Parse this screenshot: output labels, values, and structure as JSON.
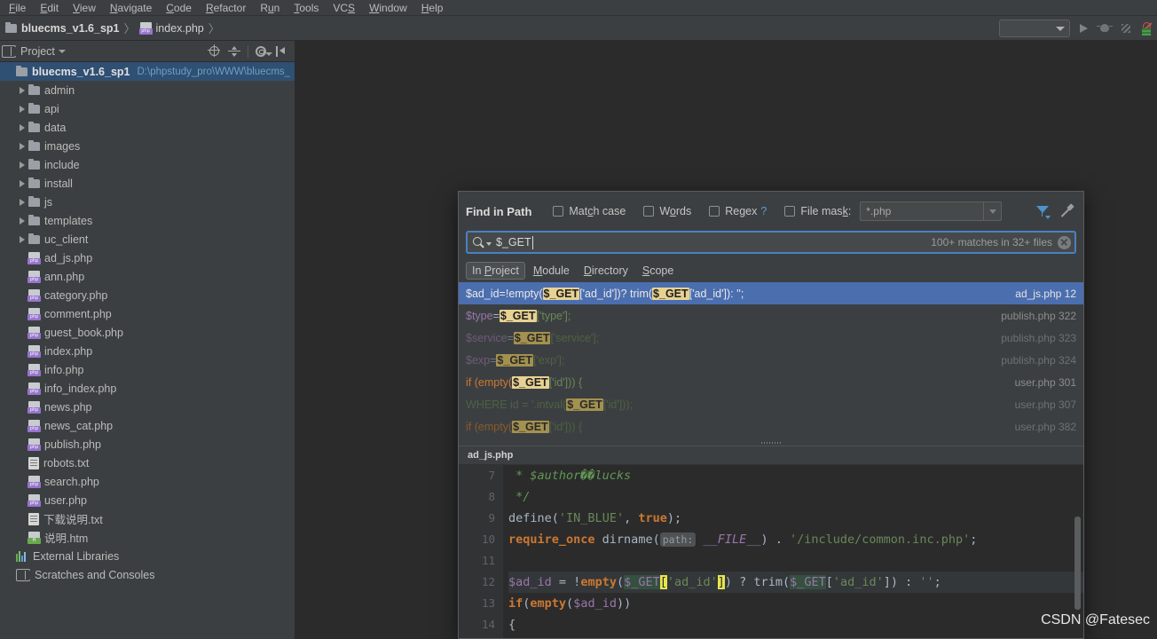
{
  "menubar": {
    "items": [
      {
        "label": "File",
        "mnemonic": "F"
      },
      {
        "label": "Edit",
        "mnemonic": "E"
      },
      {
        "label": "View",
        "mnemonic": "V"
      },
      {
        "label": "Navigate",
        "mnemonic": "N"
      },
      {
        "label": "Code",
        "mnemonic": "C"
      },
      {
        "label": "Refactor",
        "mnemonic": "R"
      },
      {
        "label": "Run",
        "mnemonic": "u"
      },
      {
        "label": "Tools",
        "mnemonic": "T"
      },
      {
        "label": "VCS",
        "mnemonic": "S"
      },
      {
        "label": "Window",
        "mnemonic": "W"
      },
      {
        "label": "Help",
        "mnemonic": "H"
      }
    ]
  },
  "breadcrumb": {
    "project": "bluecms_v1.6_sp1",
    "file": "index.php",
    "separator": "〉"
  },
  "toolbar": {
    "run_config_placeholder": "",
    "icons": [
      "run-icon",
      "debug-icon",
      "coverage-icon",
      "stop-icon"
    ]
  },
  "sidebar": {
    "title": "Project",
    "tools": [
      "locate-icon",
      "collapse-all-icon",
      "settings-gear-icon",
      "hide-panel-icon"
    ],
    "root": {
      "label": "bluecms_v1.6_sp1",
      "path": "D:\\phpstudy_pro\\WWW\\bluecms_",
      "selected": true
    },
    "folders": [
      {
        "label": "admin"
      },
      {
        "label": "api"
      },
      {
        "label": "data"
      },
      {
        "label": "images"
      },
      {
        "label": "include"
      },
      {
        "label": "install"
      },
      {
        "label": "js"
      },
      {
        "label": "templates"
      },
      {
        "label": "uc_client"
      }
    ],
    "files": [
      {
        "label": "ad_js.php",
        "type": "php"
      },
      {
        "label": "ann.php",
        "type": "php"
      },
      {
        "label": "category.php",
        "type": "php"
      },
      {
        "label": "comment.php",
        "type": "php"
      },
      {
        "label": "guest_book.php",
        "type": "php"
      },
      {
        "label": "index.php",
        "type": "php"
      },
      {
        "label": "info.php",
        "type": "php"
      },
      {
        "label": "info_index.php",
        "type": "php"
      },
      {
        "label": "news.php",
        "type": "php"
      },
      {
        "label": "news_cat.php",
        "type": "php"
      },
      {
        "label": "publish.php",
        "type": "php"
      },
      {
        "label": "robots.txt",
        "type": "txt"
      },
      {
        "label": "search.php",
        "type": "php"
      },
      {
        "label": "user.php",
        "type": "php"
      },
      {
        "label": "下载说明.txt",
        "type": "txt"
      },
      {
        "label": "说明.htm",
        "type": "htm"
      }
    ],
    "external_libraries": "External Libraries",
    "scratches": "Scratches and Consoles"
  },
  "find_dialog": {
    "title": "Find in Path",
    "options": [
      {
        "label": "Match case",
        "mnemonic": "c",
        "checked": false
      },
      {
        "label": "Words",
        "mnemonic": "o",
        "checked": false
      },
      {
        "label": "Regex",
        "mnemonic": "g",
        "checked": false,
        "help": "?"
      },
      {
        "label": "File mask:",
        "mnemonic": "k",
        "checked": false
      }
    ],
    "file_mask_value": "*.php",
    "search_value": "$_GET",
    "match_count": "100+ matches in 32+ files",
    "header_icons": [
      "filter-icon",
      "pin-icon"
    ],
    "scope_tabs": [
      {
        "label": "In Project",
        "mnemonic": "P",
        "active": true
      },
      {
        "label": "Module",
        "mnemonic": "M",
        "active": false
      },
      {
        "label": "Directory",
        "mnemonic": "D",
        "active": false
      },
      {
        "label": "Scope",
        "mnemonic": "S",
        "active": false
      }
    ],
    "results": [
      {
        "file": "ad_js.php",
        "line": "12",
        "selected": true,
        "dim": false,
        "parts": [
          {
            "t": "$ad_id",
            "c": "var"
          },
          {
            "t": " = ",
            "c": "plain"
          },
          {
            "t": "!empty(",
            "c": "kw"
          },
          {
            "t": "$_GET",
            "c": "hl"
          },
          {
            "t": "['ad_id'])",
            "c": "str"
          },
          {
            "t": " ? trim(",
            "c": "plain"
          },
          {
            "t": "$_GET",
            "c": "hl"
          },
          {
            "t": "['ad_id'])",
            "c": "str"
          },
          {
            "t": " : '';",
            "c": "plain"
          }
        ]
      },
      {
        "file": "publish.php",
        "line": "322",
        "selected": false,
        "dim": false,
        "parts": [
          {
            "t": "$type",
            "c": "var"
          },
          {
            "t": " = ",
            "c": "plain"
          },
          {
            "t": "$_GET",
            "c": "hl"
          },
          {
            "t": "['type'];",
            "c": "str"
          }
        ]
      },
      {
        "file": "publish.php",
        "line": "323",
        "selected": false,
        "dim": true,
        "parts": [
          {
            "t": "$service",
            "c": "var"
          },
          {
            "t": " = ",
            "c": "plain"
          },
          {
            "t": "$_GET",
            "c": "hl"
          },
          {
            "t": "['service'];",
            "c": "str"
          }
        ]
      },
      {
        "file": "publish.php",
        "line": "324",
        "selected": false,
        "dim": true,
        "parts": [
          {
            "t": "$exp",
            "c": "var"
          },
          {
            "t": " = ",
            "c": "plain"
          },
          {
            "t": "$_GET",
            "c": "hl"
          },
          {
            "t": "['exp'];",
            "c": "str"
          }
        ]
      },
      {
        "file": "user.php",
        "line": "301",
        "selected": false,
        "dim": false,
        "parts": [
          {
            "t": "if (empty(",
            "c": "kw"
          },
          {
            "t": "$_GET",
            "c": "hl"
          },
          {
            "t": "['id'])) {",
            "c": "str"
          }
        ]
      },
      {
        "file": "user.php",
        "line": "307",
        "selected": false,
        "dim": true,
        "parts": [
          {
            "t": "WHERE id = '.intval(",
            "c": "str"
          },
          {
            "t": "$_GET",
            "c": "hl"
          },
          {
            "t": "['id']));",
            "c": "str"
          }
        ]
      },
      {
        "file": "user.php",
        "line": "382",
        "selected": false,
        "dim": true,
        "parts": [
          {
            "t": "if (empty(",
            "c": "kw"
          },
          {
            "t": "$_GET",
            "c": "hl"
          },
          {
            "t": "['id'])) {",
            "c": "str"
          }
        ]
      }
    ],
    "preview": {
      "filename": "ad_js.php",
      "lines": [
        {
          "num": "7",
          "highlight": false,
          "parts": [
            {
              "t": " * $author��lucks",
              "c": "com"
            }
          ]
        },
        {
          "num": "8",
          "highlight": false,
          "parts": [
            {
              "t": " */",
              "c": "com"
            }
          ]
        },
        {
          "num": "9",
          "highlight": false,
          "parts": [
            {
              "t": "define",
              "c": "fn"
            },
            {
              "t": "(",
              "c": "plain"
            },
            {
              "t": "'IN_BLUE'",
              "c": "str"
            },
            {
              "t": ", ",
              "c": "plain"
            },
            {
              "t": "true",
              "c": "kw"
            },
            {
              "t": ");",
              "c": "plain"
            }
          ]
        },
        {
          "num": "10",
          "highlight": false,
          "parts": [
            {
              "t": "require_once",
              "c": "kw"
            },
            {
              "t": " dirname(",
              "c": "fn"
            },
            {
              "t": "path:",
              "c": "hint"
            },
            {
              "t": " ",
              "c": "plain"
            },
            {
              "t": "__FILE__",
              "c": "const"
            },
            {
              "t": ") . ",
              "c": "plain"
            },
            {
              "t": "'/include/common.inc.php'",
              "c": "str"
            },
            {
              "t": ";",
              "c": "plain"
            }
          ]
        },
        {
          "num": "11",
          "highlight": false,
          "parts": [
            {
              "t": "",
              "c": "plain"
            }
          ]
        },
        {
          "num": "12",
          "highlight": true,
          "parts": [
            {
              "t": "$ad_id",
              "c": "var"
            },
            {
              "t": " = ",
              "c": "plain"
            },
            {
              "t": "!",
              "c": "plain"
            },
            {
              "t": "empty",
              "c": "kw"
            },
            {
              "t": "(",
              "c": "plain"
            },
            {
              "t": "$_GET",
              "c": "sel-soft"
            },
            {
              "t": "[",
              "c": "br-hi"
            },
            {
              "t": "'ad_id'",
              "c": "str"
            },
            {
              "t": "]",
              "c": "br-hi"
            },
            {
              "t": ") ? trim(",
              "c": "plain"
            },
            {
              "t": "$_GET",
              "c": "sel-soft"
            },
            {
              "t": "[",
              "c": "plain"
            },
            {
              "t": "'ad_id'",
              "c": "str"
            },
            {
              "t": "]) : ",
              "c": "plain"
            },
            {
              "t": "''",
              "c": "str"
            },
            {
              "t": ";",
              "c": "plain"
            }
          ]
        },
        {
          "num": "13",
          "highlight": false,
          "parts": [
            {
              "t": "if",
              "c": "kw"
            },
            {
              "t": "(",
              "c": "plain"
            },
            {
              "t": "empty",
              "c": "kw"
            },
            {
              "t": "(",
              "c": "plain"
            },
            {
              "t": "$ad_id",
              "c": "var"
            },
            {
              "t": "))",
              "c": "plain"
            }
          ]
        },
        {
          "num": "14",
          "highlight": false,
          "parts": [
            {
              "t": "{",
              "c": "plain"
            }
          ]
        }
      ]
    }
  },
  "watermark": "CSDN @Fatesec",
  "colors": {
    "bg_panel": "#3c3f41",
    "bg_editor": "#2b2b2b",
    "selection_blue": "#4b6eaf",
    "tree_selection": "#2f4f73",
    "highlight_yellow": "#e8d292",
    "accent_blue": "#4b94d0"
  }
}
